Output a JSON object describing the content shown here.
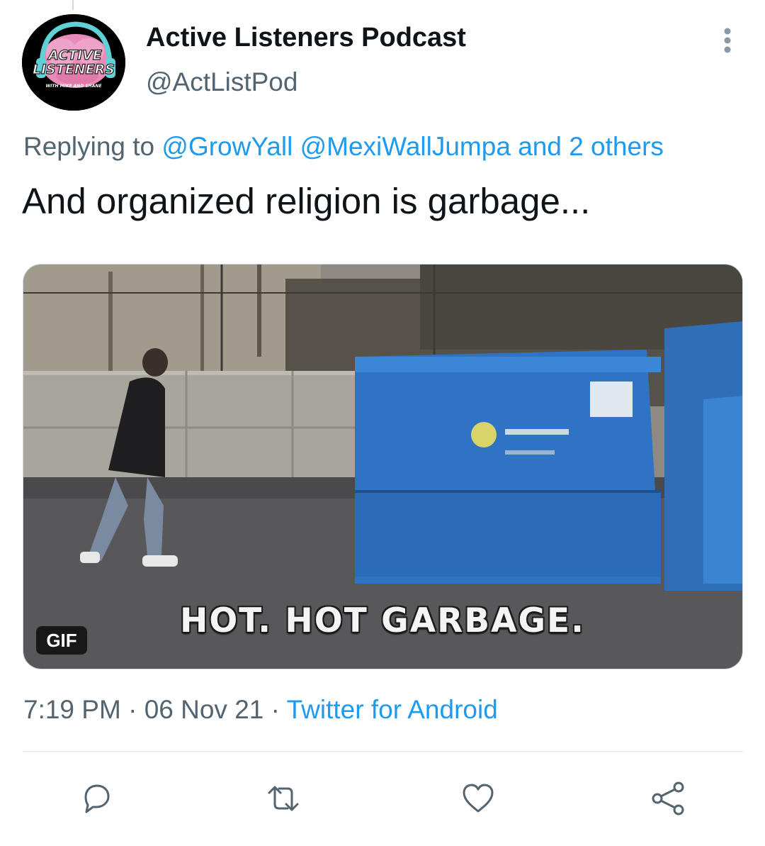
{
  "tweet": {
    "author": {
      "display_name": "Active Listeners Podcast",
      "handle": "@ActListPod",
      "avatar_logo": {
        "line1": "ACTIVE",
        "line2": "LISTENERS",
        "tagline": "WITH MIKE AND SHANE"
      }
    },
    "replying_to": {
      "prefix": "Replying to",
      "mention_1": "@GrowYall",
      "mention_2": "@MexiWallJumpa",
      "others": "and 2 others"
    },
    "text": "And organized religion is garbage...",
    "media": {
      "caption": "HOT. HOT GARBAGE.",
      "badge": "GIF"
    },
    "meta": {
      "time": "7:19 PM",
      "separator": "·",
      "date": "06 Nov 21",
      "source": "Twitter for Android"
    }
  },
  "icons": {
    "more": "more-vertical-icon",
    "reply": "reply-icon",
    "retweet": "retweet-icon",
    "like": "like-icon",
    "share": "share-icon"
  },
  "colors": {
    "accent": "#1d9bf0",
    "secondary_text": "#536471",
    "primary_text": "#0f1419",
    "action_icon": "#536471"
  }
}
